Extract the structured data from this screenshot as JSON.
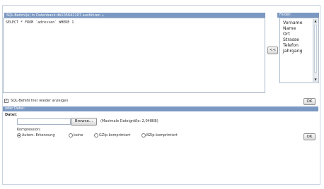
{
  "sql_panel": {
    "title": "SQL-Befehl(e) in Datenbank db105642107 ausführen",
    "title_arrow": "◇",
    "query": "SELECT * FROM `adressen` WHERE 1",
    "show_again_label": "SQL-Befehl hier wieder anzeigen",
    "show_again_checked": true,
    "ok_label": "OK"
  },
  "fields_panel": {
    "title": "Felder:",
    "items": [
      "Vorname",
      "Name",
      "Ort",
      "Strasse",
      "Telefon",
      "Jahrgang"
    ],
    "insert_button": "<<"
  },
  "file_panel": {
    "title": "oder Datei:",
    "file_label": "Datei:",
    "browse_label": "Browse...",
    "max_size_text": "(Maximale Dateigröße: 2,048KB)",
    "compression_label": "Kompression:",
    "options": [
      {
        "label": "Autom. Erkennung",
        "selected": true
      },
      {
        "label": "keine",
        "selected": false
      },
      {
        "label": "GZip-komprimiert",
        "selected": false
      },
      {
        "label": "BZip-komprimiert",
        "selected": false
      }
    ],
    "ok_label": "OK"
  },
  "colors": {
    "header": "#7a98c2",
    "border": "#a8b6c7"
  }
}
